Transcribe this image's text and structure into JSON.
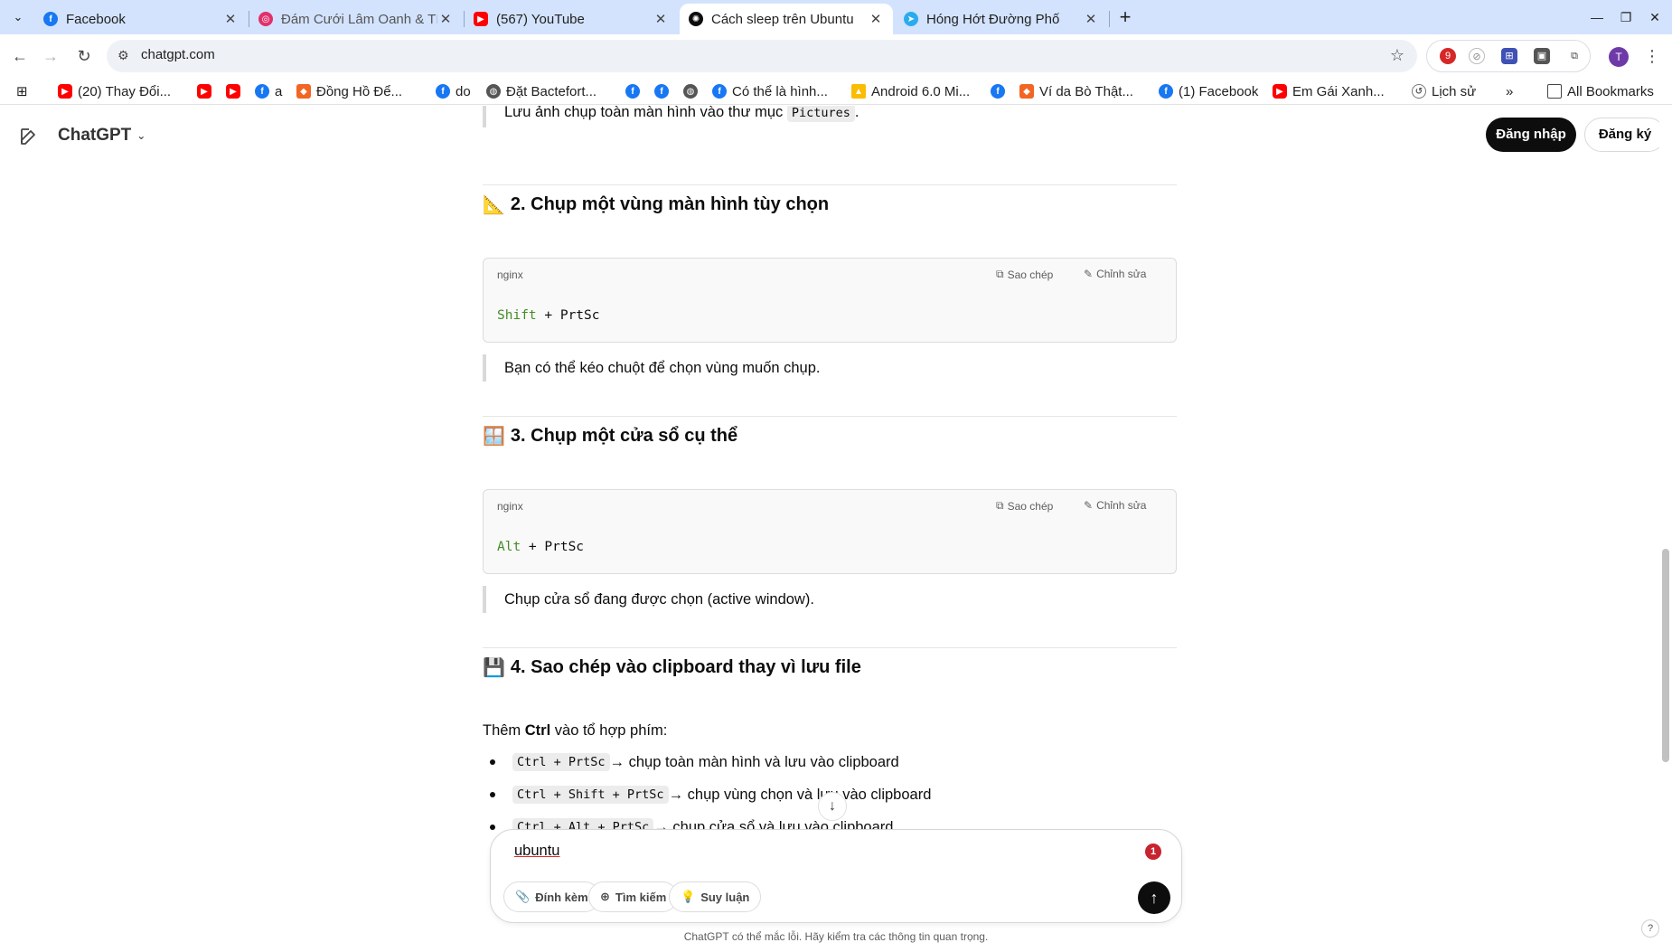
{
  "tabs": [
    {
      "title": "Facebook",
      "icon": "facebook-icon",
      "color": "#1877f2"
    },
    {
      "title": "Đám Cưới Lâm Oanh & Tí",
      "icon": "instagram-icon",
      "color": "#e1306c"
    },
    {
      "title": "(567) YouTube",
      "icon": "youtube-icon",
      "color": "#ff0000"
    },
    {
      "title": "Cách sleep trên Ubuntu",
      "icon": "chatgpt-icon",
      "color": "#0d0d0d"
    },
    {
      "title": "Hóng Hớt Đường Phố",
      "icon": "telegram-icon",
      "color": "#2aabee"
    }
  ],
  "toolbar": {
    "url": "chatgpt.com",
    "extension_badge": "9",
    "profile_initial": "T"
  },
  "bookmarks": {
    "items": [
      {
        "label": "(20) Thay Đổi...",
        "icon": "youtube-icon"
      },
      {
        "label": "",
        "icon": "youtube-icon"
      },
      {
        "label": "",
        "icon": "youtube-icon"
      },
      {
        "label": "a",
        "icon": "facebook-icon"
      },
      {
        "label": "Đồng Hồ Để...",
        "icon": "orange-site-icon"
      },
      {
        "label": "do",
        "icon": "facebook-icon"
      },
      {
        "label": "Đặt Bactefort...",
        "icon": "globe-icon"
      },
      {
        "label": "",
        "icon": "facebook-icon"
      },
      {
        "label": "",
        "icon": "facebook-icon"
      },
      {
        "label": "",
        "icon": "globe-icon"
      },
      {
        "label": "Có thể là hình...",
        "icon": "facebook-icon"
      },
      {
        "label": "Android 6.0 Mi...",
        "icon": "drive-icon"
      },
      {
        "label": "",
        "icon": "facebook-icon"
      },
      {
        "label": "Ví da Bò Thật...",
        "icon": "orange-site-icon"
      },
      {
        "label": "(1) Facebook",
        "icon": "facebook-icon"
      },
      {
        "label": "Em Gái Xanh...",
        "icon": "youtube-icon"
      },
      {
        "label": "Lịch sử",
        "icon": "history-icon"
      }
    ],
    "overflow": "»",
    "all_bookmarks": "All Bookmarks"
  },
  "header": {
    "brand": "ChatGPT",
    "login": "Đăng nhập",
    "signup": "Đăng ký"
  },
  "content": {
    "top_quote_prefix": "Lưu ảnh chụp toàn màn hình vào thư mục ",
    "top_quote_code": "Pictures",
    "top_quote_suffix": ".",
    "section2": {
      "emoji": "📐",
      "title": "2. Chụp một vùng màn hình tùy chọn",
      "lang": "nginx",
      "copy": "Sao chép",
      "edit": "Chỉnh sửa",
      "code_kw": "Shift",
      "code_rest": " + PrtSc",
      "note": "Bạn có thể kéo chuột để chọn vùng muốn chụp."
    },
    "section3": {
      "emoji": "🪟",
      "title": "3. Chụp một cửa sổ cụ thể",
      "lang": "nginx",
      "copy": "Sao chép",
      "edit": "Chỉnh sửa",
      "code_kw": "Alt",
      "code_rest": " + PrtSc",
      "note": "Chụp cửa sổ đang được chọn (active window)."
    },
    "section4": {
      "emoji": "💾",
      "title": "4. Sao chép vào clipboard thay vì lưu file",
      "intro_prefix": "Thêm ",
      "intro_bold": "Ctrl",
      "intro_suffix": " vào tổ hợp phím:",
      "items": [
        {
          "code": "Ctrl + PrtSc",
          "text": " → chụp toàn màn hình và lưu vào clipboard"
        },
        {
          "code": "Ctrl + Shift + PrtSc",
          "text": " → chụp vùng chọn và lưu vào clipboard"
        },
        {
          "code": "Ctrl + Alt + PrtSc",
          "text": " → chụp cửa sổ và lưu vào clipboard"
        }
      ]
    }
  },
  "composer": {
    "value": "ubuntu",
    "badge": "1",
    "attach": "Đính kèm",
    "search": "Tìm kiếm",
    "reason": "Suy luận"
  },
  "footer": {
    "disclaimer": "ChatGPT có thể mắc lỗi. Hãy kiểm tra các thông tin quan trọng.",
    "help": "?"
  }
}
